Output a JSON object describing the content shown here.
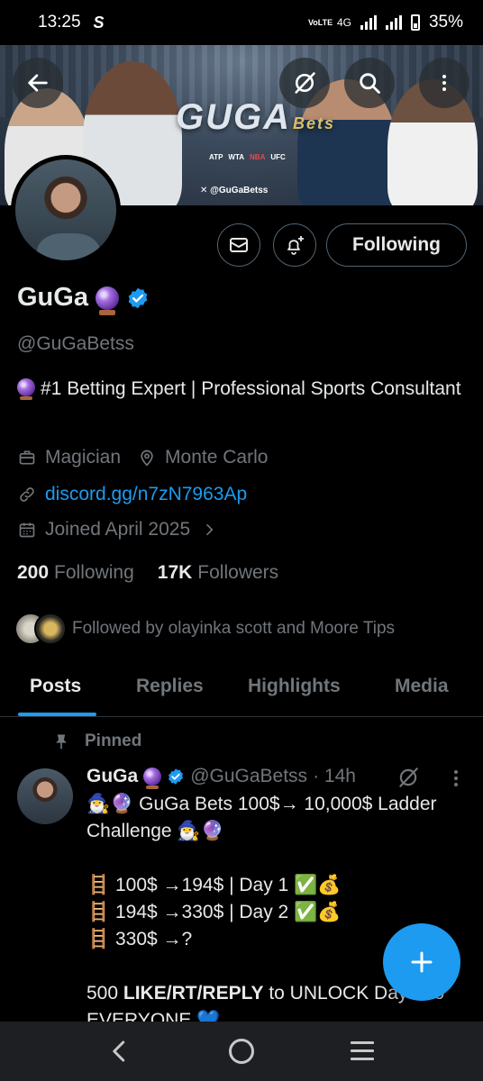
{
  "status_bar": {
    "time": "13:25",
    "app_glyph": "S",
    "network_volte": "VoLTE",
    "network_4g": "4G",
    "battery": "35%"
  },
  "banner": {
    "logo_main": "GUGA",
    "logo_sub": "Bets",
    "leagues": [
      "ATP",
      "WTA",
      "NBA",
      "UFC"
    ],
    "handle": "✕ @GuGaBetss"
  },
  "profile": {
    "name": "GuGa",
    "handle": "@GuGaBetss",
    "bio_line": "#1 Betting Expert | Professional Sports Consultant",
    "profession": "Magician",
    "location": "Monte Carlo",
    "link": "discord.gg/n7zN7963Ap",
    "joined": "Joined April 2025",
    "following_count": "200",
    "following_label": "Following",
    "followers_count": "17K",
    "followers_label": "Followers",
    "followed_by": "Followed by olayinka scott and Moore Tips",
    "follow_button": "Following"
  },
  "tabs": [
    "Posts",
    "Replies",
    "Highlights",
    "Media"
  ],
  "pinned_post": {
    "pinned_label": "Pinned",
    "author_name": "GuGa",
    "author_handle": "@GuGaBetss",
    "time": "· 14h",
    "line1": "🧙‍♂️🔮 GuGa Bets 100$→ 10,000$ Ladder Challenge 🧙‍♂️🔮",
    "line2": "🪜 100$ →194$ | Day 1 ✅💰",
    "line3": "🪜 194$ →330$ | Day 2 ✅💰",
    "line4": "🪜 330$ →?",
    "line5_pre": "500 ",
    "line5_bold1": "LIKE",
    "line5_sep1": "/",
    "line5_bold2": "RT",
    "line5_sep2": "/",
    "line5_bold3": "REPLY",
    "line5_post": " to UNLOCK Day 3 to EVERYONE 💙"
  },
  "colors": {
    "accent": "#1d9bf0",
    "background": "#000000",
    "secondary_text": "#71767b",
    "primary_text": "#e7e9ea"
  }
}
